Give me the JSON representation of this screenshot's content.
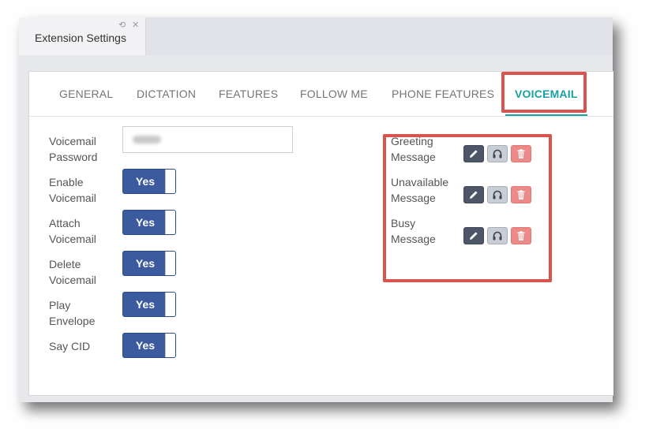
{
  "window": {
    "tab_title": "Extension Settings",
    "refresh_glyph": "⟲",
    "close_glyph": "✕"
  },
  "nav": {
    "items": [
      {
        "label": "GENERAL",
        "active": false
      },
      {
        "label": "DICTATION",
        "active": false
      },
      {
        "label": "FEATURES",
        "active": false
      },
      {
        "label": "FOLLOW ME",
        "active": false
      },
      {
        "label": "PHONE FEATURES",
        "active": false
      },
      {
        "label": "VOICEMAIL",
        "active": true
      }
    ],
    "accent_color": "#17a2a1"
  },
  "settings": {
    "password": {
      "label_line1": "Voicemail",
      "label_line2": "Password",
      "value_obscured": true
    },
    "enable_voicemail": {
      "label_line1": "Enable",
      "label_line2": "Voicemail",
      "value": "Yes"
    },
    "attach_voicemail": {
      "label_line1": "Attach",
      "label_line2": "Voicemail",
      "value": "Yes"
    },
    "delete_voicemail": {
      "label_line1": "Delete",
      "label_line2": "Voicemail",
      "value": "Yes"
    },
    "play_envelope": {
      "label_line1": "Play",
      "label_line2": "Envelope",
      "value": "Yes"
    },
    "say_cid": {
      "label": "Say CID",
      "value": "Yes"
    }
  },
  "messages": {
    "greeting": {
      "label_line1": "Greeting",
      "label_line2": "Message"
    },
    "unavailable": {
      "label_line1": "Unavailable",
      "label_line2": "Message"
    },
    "busy": {
      "label_line1": "Busy",
      "label_line2": "Message"
    },
    "actions": [
      "pencil-icon",
      "headphones-icon",
      "trash-icon"
    ]
  },
  "colors": {
    "toggle_on": "#3b5b9e",
    "highlight_border": "#d9534f",
    "edit_button": "#4c5666",
    "listen_button": "#c9ced4",
    "delete_button": "#ec8a87"
  }
}
